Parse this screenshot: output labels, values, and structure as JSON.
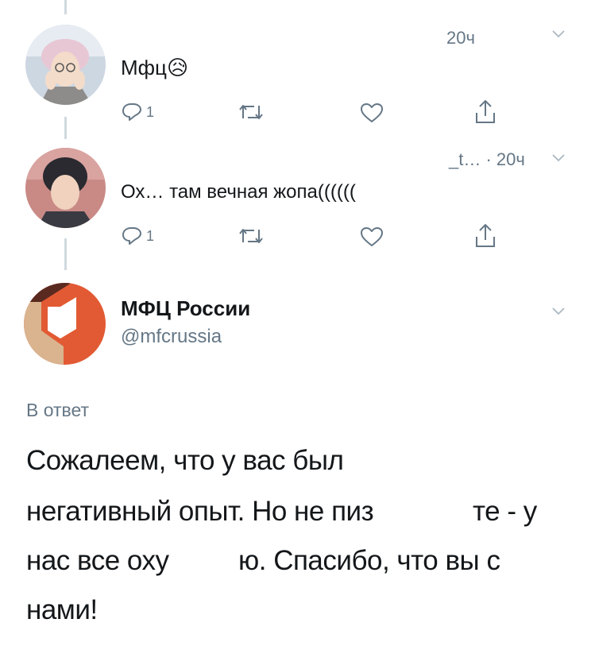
{
  "thread": [
    {
      "text": "Мфц😥",
      "time": "20ч",
      "replies_count": "1"
    },
    {
      "text": "Ох… там вечная жопа((((((",
      "time": "_t… · 20ч",
      "replies_count": "1"
    }
  ],
  "main_tweet": {
    "display_name": "МФЦ России",
    "handle": "@mfcrussia",
    "reply_label": "В ответ",
    "lines": [
      "Сожалеем, что у вас был",
      "негативный опыт. Но не пиз",
      "те - у",
      "нас все оху",
      "ю. Спасибо, что вы с",
      "нами!"
    ],
    "brand_colors": {
      "dark": "#5a2a20",
      "orange": "#e25a33",
      "beige": "#d9b48f"
    }
  },
  "icons": [
    "reply-icon",
    "retweet-icon",
    "like-icon",
    "share-icon",
    "chevron-down-icon"
  ]
}
